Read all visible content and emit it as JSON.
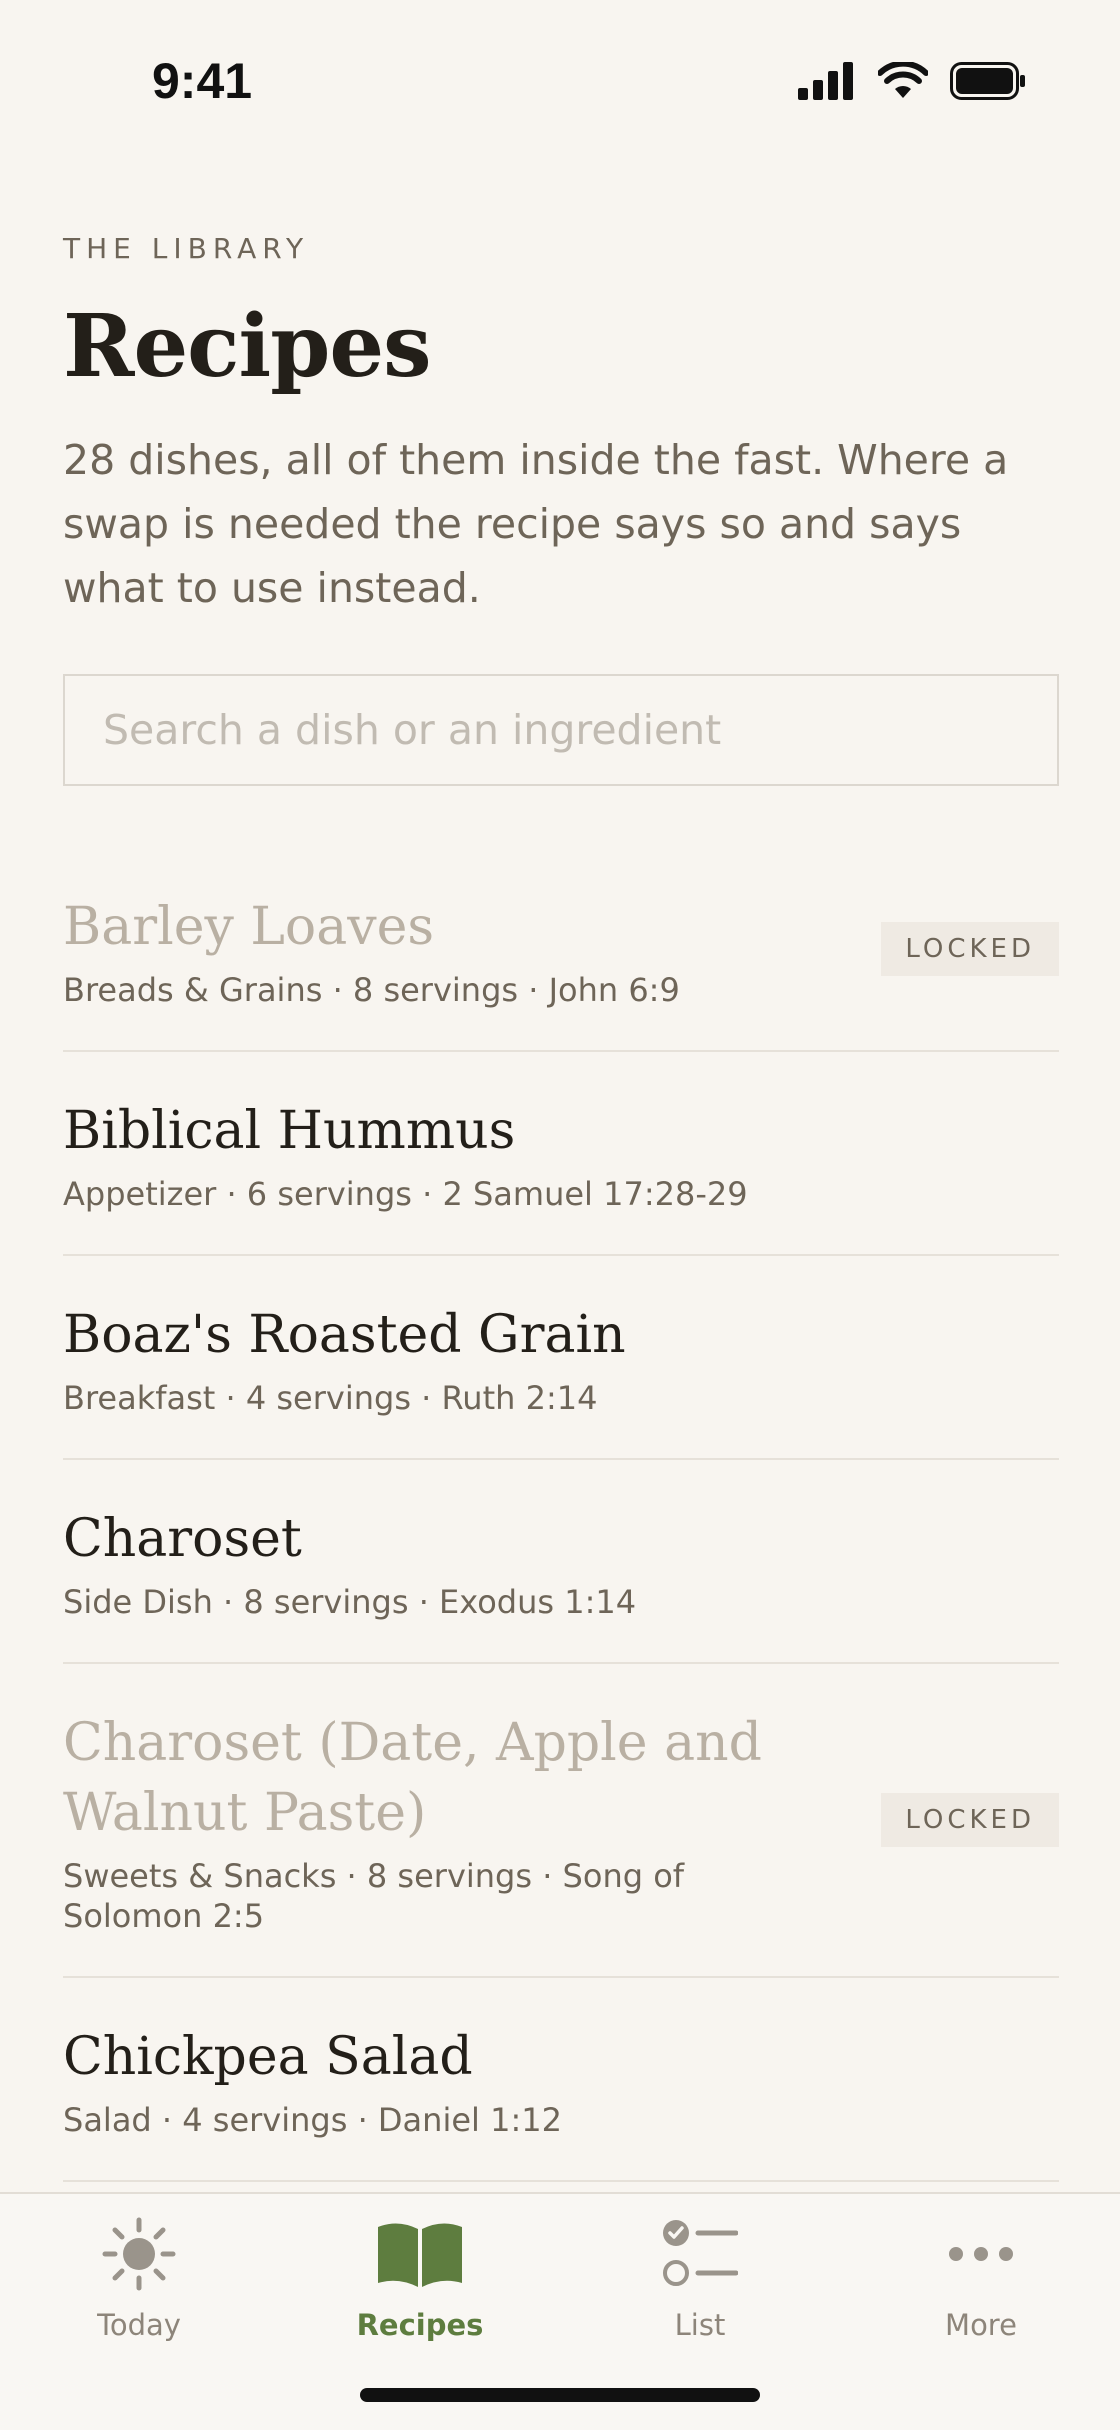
{
  "status_bar": {
    "time": "9:41"
  },
  "header": {
    "eyebrow": "THE LIBRARY",
    "title": "Recipes",
    "intro": "28 dishes, all of them inside the fast. Where a swap is needed the recipe says so and says what to use instead."
  },
  "search": {
    "placeholder": "Search a dish or an ingredient",
    "value": ""
  },
  "recipes": [
    {
      "name": "Barley Loaves",
      "meta": "Breads & Grains · 8 servings · John 6:9",
      "badge": "LOCKED"
    },
    {
      "name": "Biblical Hummus",
      "meta": "Appetizer · 6 servings · 2 Samuel 17:28-29"
    },
    {
      "name": "Boaz's Roasted Grain",
      "meta": "Breakfast · 4 servings · Ruth 2:14"
    },
    {
      "name": "Charoset",
      "meta": "Side Dish · 8 servings · Exodus 1:14"
    },
    {
      "name": "Charoset (Date, Apple and Walnut Paste)",
      "meta": "Sweets & Snacks · 8 servings · Song of Solomon 2:5",
      "badge": "LOCKED"
    },
    {
      "name": "Chickpea Salad",
      "meta": "Salad · 4 servings · Daniel 1:12"
    }
  ],
  "tabs": [
    {
      "label": "Today",
      "icon": "sun-icon"
    },
    {
      "label": "Recipes",
      "icon": "open-book-icon"
    },
    {
      "label": "List",
      "icon": "checklist-icon"
    },
    {
      "label": "More",
      "icon": "ellipsis-icon"
    }
  ],
  "colors": {
    "accent": "#5e7d3f",
    "background": "#f8f5f0",
    "muted": "#6e6558"
  }
}
